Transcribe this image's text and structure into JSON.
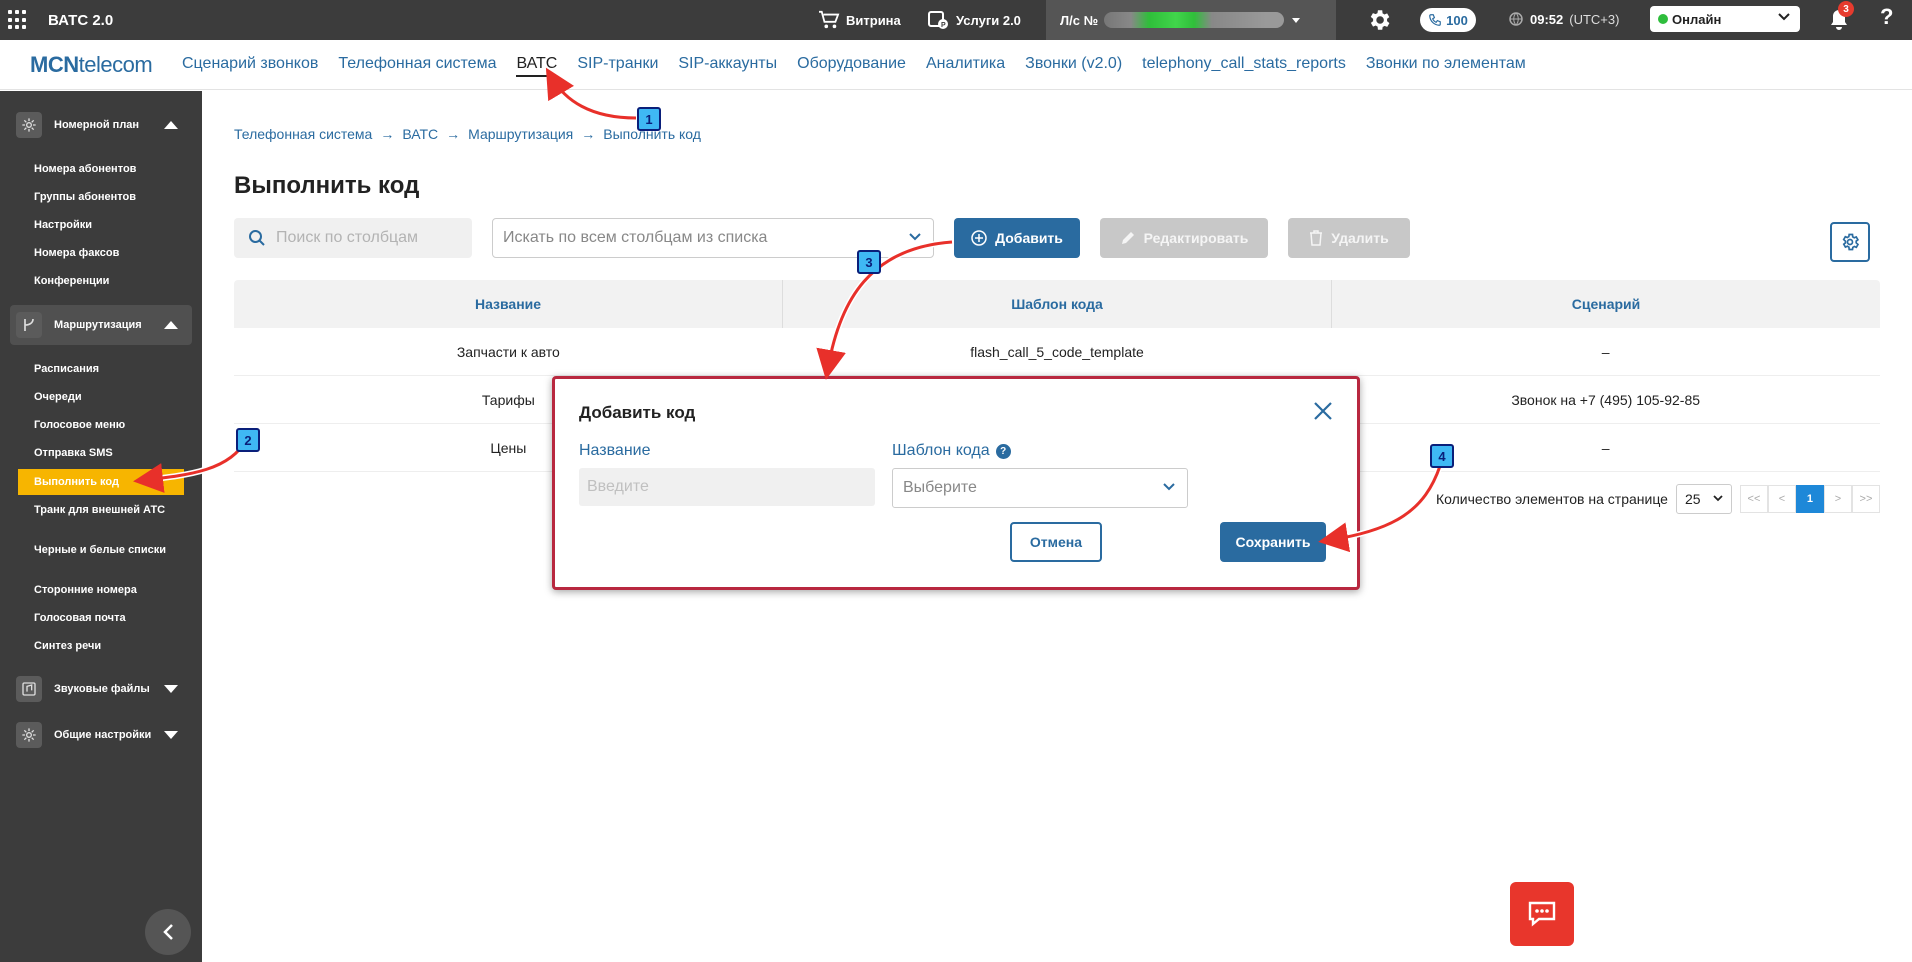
{
  "topbar": {
    "brand": "ВАТС 2.0",
    "showcase_label": "Витрина",
    "services_label": "Услуги 2.0",
    "account_label": "Л/с №",
    "calls_count": "100",
    "time": "09:52",
    "timezone": "(UTC+3)",
    "status": "Онлайн",
    "notifications_count": "3",
    "help": "?"
  },
  "navbar": {
    "logo_bold": "MCN",
    "logo_rest": "telecom",
    "links": [
      "Сценарий звонков",
      "Телефонная система",
      "ВАТС",
      "SIP-транки",
      "SIP-аккаунты",
      "Оборудование",
      "Аналитика",
      "Звонки (v2.0)",
      "telephony_call_stats_reports",
      "Звонки по элементам"
    ]
  },
  "sidebar": {
    "sections": [
      {
        "label": "Номерной план",
        "items": [
          "Номера абонентов",
          "Группы абонентов",
          "Настройки",
          "Номера факсов",
          "Конференции"
        ]
      },
      {
        "label": "Маршрутизация",
        "items": [
          "Расписания",
          "Очереди",
          "Голосовое меню",
          "Отправка SMS",
          "Выполнить код",
          "Транк для внешней АТС",
          "Черные и белые списки",
          "Сторонние номера",
          "Голосовая почта",
          "Синтез речи"
        ]
      },
      {
        "label": "Звуковые файлы"
      },
      {
        "label": "Общие настройки"
      }
    ]
  },
  "breadcrumb": [
    "Телефонная система",
    "ВАТС",
    "Маршрутизация",
    "Выполнить код"
  ],
  "page_title": "Выполнить код",
  "toolbar": {
    "search_placeholder": "Поиск по столбцам",
    "search_all_placeholder": "Искать по всем столбцам из списка",
    "add_label": "Добавить",
    "edit_label": "Редактировать",
    "delete_label": "Удалить"
  },
  "table": {
    "columns": [
      "Название",
      "Шаблон кода",
      "Сценарий"
    ],
    "rows": [
      [
        "Запчасти к авто",
        "flash_call_5_code_template",
        "–"
      ],
      [
        "Тарифы",
        "",
        "Звонок на +7 (495) 105-92-85"
      ],
      [
        "Цены",
        "",
        "–"
      ]
    ]
  },
  "pagination": {
    "per_page_label": "Количество элементов на странице",
    "per_page_value": "25",
    "first": "<<",
    "prev": "<",
    "current": "1",
    "next": ">",
    "last": ">>"
  },
  "modal": {
    "title": "Добавить код",
    "name_label": "Название",
    "name_placeholder": "Введите",
    "template_label": "Шаблон кода",
    "template_placeholder": "Выберите",
    "cancel_label": "Отмена",
    "save_label": "Сохранить"
  },
  "markers": [
    "1",
    "2",
    "3",
    "4"
  ],
  "colors": {
    "accent": "#2a6ba0",
    "sidebar_bg": "#3c3c3c",
    "active_item": "#f7b500",
    "modal_border": "#b8283f",
    "arrow": "#e8302a",
    "chat": "#e8362c"
  }
}
